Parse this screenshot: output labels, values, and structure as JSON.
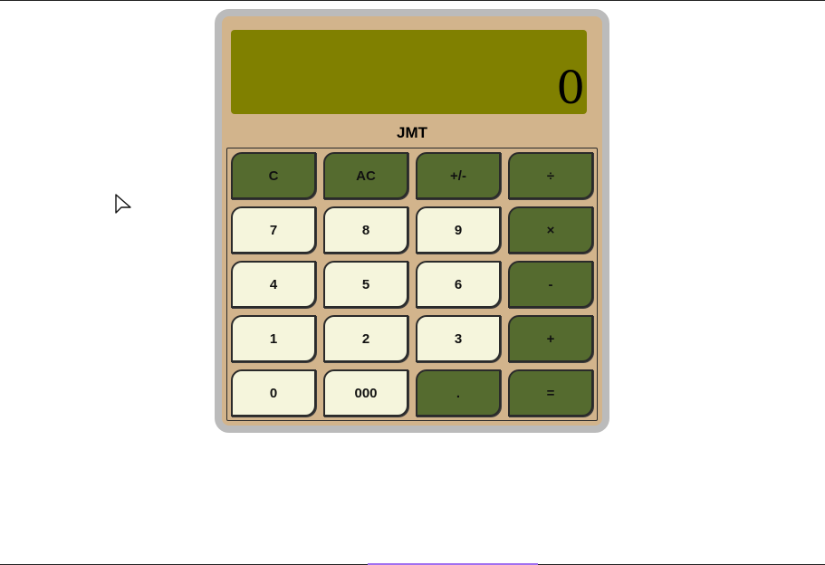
{
  "calculator": {
    "display_value": "0",
    "brand": "JMT",
    "keys": [
      {
        "label": "C",
        "name": "clear-button",
        "style": "dark"
      },
      {
        "label": "AC",
        "name": "all-clear-button",
        "style": "dark"
      },
      {
        "label": "+/-",
        "name": "toggle-sign-button",
        "style": "dark"
      },
      {
        "label": "÷",
        "name": "divide-button",
        "style": "dark"
      },
      {
        "label": "7",
        "name": "digit-7-button",
        "style": "light"
      },
      {
        "label": "8",
        "name": "digit-8-button",
        "style": "light"
      },
      {
        "label": "9",
        "name": "digit-9-button",
        "style": "light"
      },
      {
        "label": "×",
        "name": "multiply-button",
        "style": "dark"
      },
      {
        "label": "4",
        "name": "digit-4-button",
        "style": "light"
      },
      {
        "label": "5",
        "name": "digit-5-button",
        "style": "light"
      },
      {
        "label": "6",
        "name": "digit-6-button",
        "style": "light"
      },
      {
        "label": "-",
        "name": "subtract-button",
        "style": "dark"
      },
      {
        "label": "1",
        "name": "digit-1-button",
        "style": "light"
      },
      {
        "label": "2",
        "name": "digit-2-button",
        "style": "light"
      },
      {
        "label": "3",
        "name": "digit-3-button",
        "style": "light"
      },
      {
        "label": "+",
        "name": "add-button",
        "style": "dark"
      },
      {
        "label": "0",
        "name": "digit-0-button",
        "style": "light"
      },
      {
        "label": "000",
        "name": "triple-zero-button",
        "style": "light"
      },
      {
        "label": ".",
        "name": "decimal-point-button",
        "style": "dark"
      },
      {
        "label": "=",
        "name": "equals-button",
        "style": "dark"
      }
    ]
  },
  "colors": {
    "body": "#d2b48c",
    "frame": "#bbbbbb",
    "display": "#808000",
    "key_dark": "#556b2f",
    "key_light": "#f5f5dc",
    "accent_line": "#a070f0"
  },
  "icons": {
    "cursor": "mouse-pointer-icon"
  }
}
